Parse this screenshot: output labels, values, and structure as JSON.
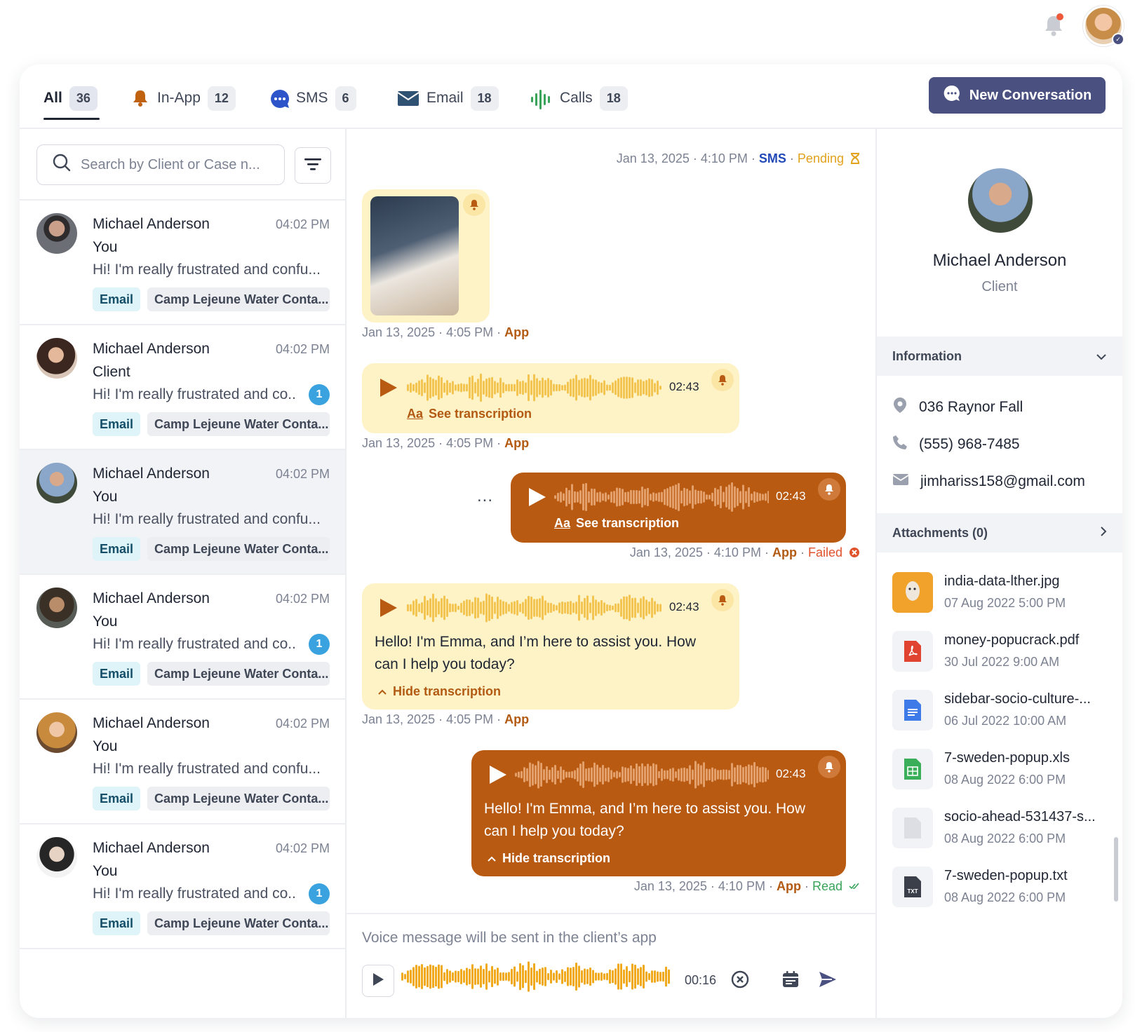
{
  "topbar": {
    "avatar_badge": "✓"
  },
  "tabs": [
    {
      "label": "All",
      "count": "36"
    },
    {
      "label": "In-App",
      "count": "12"
    },
    {
      "label": "SMS",
      "count": "6"
    },
    {
      "label": "Email",
      "count": "18"
    },
    {
      "label": "Calls",
      "count": "18"
    }
  ],
  "new_conversation_label": "New Conversation",
  "search": {
    "placeholder": "Search by Client or Case n..."
  },
  "conversations": [
    {
      "name": "Michael Anderson",
      "time": "04:02 PM",
      "who": "You",
      "preview": "Hi! I'm really frustrated and confu...",
      "unread": "",
      "channel": "Email",
      "case": "Camp Lejeune Water Conta..."
    },
    {
      "name": "Michael Anderson",
      "time": "04:02 PM",
      "who": "Client",
      "preview": "Hi! I'm really frustrated and co...",
      "unread": "1",
      "channel": "Email",
      "case": "Camp Lejeune Water Conta..."
    },
    {
      "name": "Michael Anderson",
      "time": "04:02 PM",
      "who": "You",
      "preview": "Hi! I'm really frustrated and confu...",
      "unread": "",
      "channel": "Email",
      "case": "Camp Lejeune Water Conta..."
    },
    {
      "name": "Michael Anderson",
      "time": "04:02 PM",
      "who": "You",
      "preview": "Hi! I'm really frustrated and co...",
      "unread": "1",
      "channel": "Email",
      "case": "Camp Lejeune Water Conta..."
    },
    {
      "name": "Michael Anderson",
      "time": "04:02 PM",
      "who": "You",
      "preview": "Hi! I'm really frustrated and confu...",
      "unread": "",
      "channel": "Email",
      "case": "Camp Lejeune Water Conta..."
    },
    {
      "name": "Michael Anderson",
      "time": "04:02 PM",
      "who": "You",
      "preview": "Hi! I'm really frustrated and co...",
      "unread": "1",
      "channel": "Email",
      "case": "Camp Lejeune Water Conta..."
    }
  ],
  "thread": {
    "meta1": {
      "date": "Jan 13, 2025 · 4:10 PM",
      "sep": " · ",
      "channel": "SMS",
      "status": "Pending"
    },
    "meta2": {
      "date": "Jan 13, 2025 · 4:05 PM",
      "sep": " · ",
      "channel": "App"
    },
    "meta3": {
      "date": "Jan 13, 2025 · 4:05 PM",
      "sep": " · ",
      "channel": "App"
    },
    "meta4": {
      "date": "Jan 13, 2025 · 4:10 PM",
      "sep": " · ",
      "channel": "App",
      "status": "Failed"
    },
    "meta5": {
      "date": "Jan 13, 2025 · 4:05 PM",
      "sep": " · ",
      "channel": "App"
    },
    "meta6": {
      "date": "Jan 13, 2025 · 4:10 PM",
      "sep": " · ",
      "channel": "App",
      "status": "Read"
    },
    "duration": "02:43",
    "see_transcription": "See transcription",
    "hide_transcription": "Hide transcription",
    "transcript": "Hello! I'm Emma, and I’m here to assist you. How can I help you today?",
    "more": "..."
  },
  "composer": {
    "hint": "Voice message will be sent in the client’s app",
    "duration": "00:16"
  },
  "profile": {
    "name": "Michael Anderson",
    "role": "Client"
  },
  "information": {
    "title": "Information",
    "address": "036 Raynor Fall",
    "phone": "(555) 968-7485",
    "email": "jimhariss158@gmail.com"
  },
  "attachments": {
    "title": "Attachments (0)",
    "items": [
      {
        "name": "india-data-lther.jpg",
        "date": "07 Aug 2022 5:00 PM",
        "icon": "image-file-icon"
      },
      {
        "name": "money-popucrack.pdf",
        "date": "30 Jul 2022 9:00 AM",
        "icon": "pdf-file-icon"
      },
      {
        "name": "sidebar-socio-culture-...",
        "date": "06 Jul 2022 10:00 AM",
        "icon": "doc-file-icon"
      },
      {
        "name": "7-sweden-popup.xls",
        "date": "08 Aug 2022 6:00 PM",
        "icon": "sheet-file-icon"
      },
      {
        "name": "socio-ahead-531437-s...",
        "date": "08 Aug 2022 6:00 PM",
        "icon": "generic-file-icon"
      },
      {
        "name": "7-sweden-popup.txt",
        "date": "08 Aug 2022 6:00 PM",
        "icon": "txt-file-icon",
        "badge": "TXT"
      }
    ]
  },
  "colors": {
    "primary": "#4a5180",
    "light_bubble": "#fdf3c6",
    "dark_bubble": "#b85a12",
    "wave_light": "#f4c451",
    "wave_dark": "#e3a06a",
    "composer_wave": "#f0a91a"
  }
}
